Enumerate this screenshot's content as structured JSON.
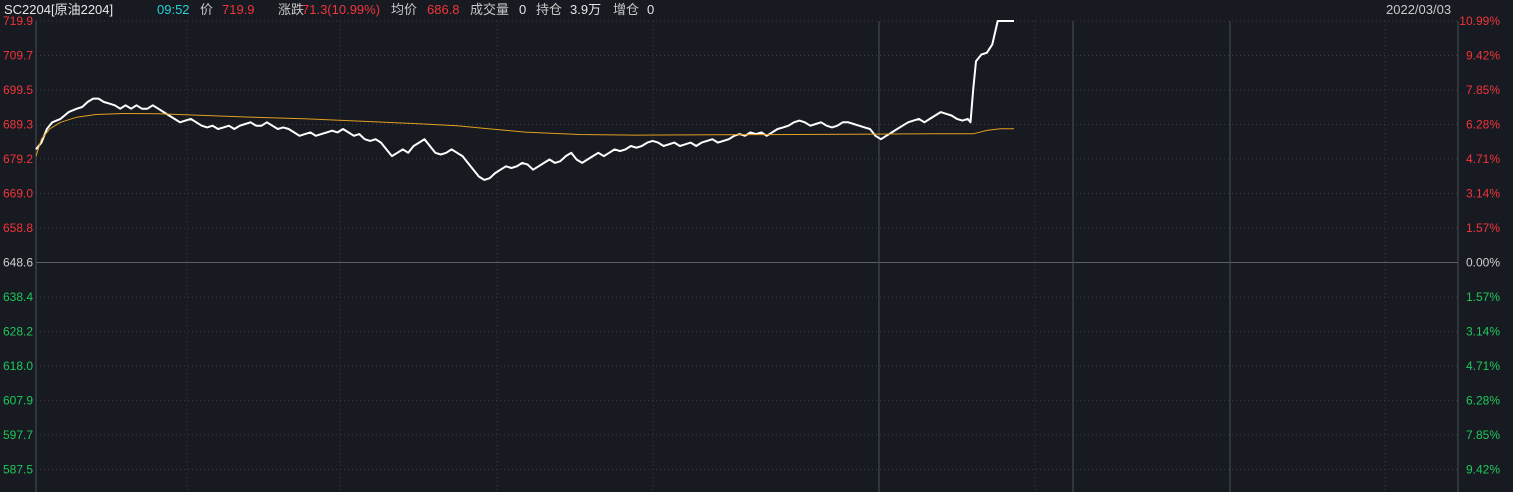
{
  "header": {
    "symbol": "SC2204[原油2204]",
    "time": "09:52",
    "price_label": "价",
    "price": "719.9",
    "change_label": "涨跌",
    "change": "71.3(10.99%)",
    "avg_label": "均价",
    "avg": "686.8",
    "volume_label": "成交量",
    "volume": "0",
    "oi_label": "持仓",
    "oi": "3.9万",
    "oi_change_label": "增仓",
    "oi_change": "0",
    "date": "2022/03/03"
  },
  "colors": {
    "background": "#171a21",
    "up": "#f0353b",
    "down": "#1ec85a",
    "neutral": "#d0d0d0",
    "price_line": "#ffffff",
    "avg_line": "#e0a020",
    "grid": "#3a3d44"
  },
  "chart_data": {
    "type": "line",
    "reference_price": 648.6,
    "ylim": [
      580.0,
      719.9
    ],
    "left_ticks": [
      "719.9",
      "709.7",
      "699.5",
      "689.3",
      "679.2",
      "669.0",
      "658.8",
      "648.6",
      "638.4",
      "628.2",
      "618.0",
      "607.9",
      "597.7",
      "587.5"
    ],
    "right_ticks": [
      "10.99%",
      "9.42%",
      "7.85%",
      "6.28%",
      "4.71%",
      "3.14%",
      "1.57%",
      "0.00%",
      "1.57%",
      "3.14%",
      "4.71%",
      "6.28%",
      "7.85%",
      "9.42%"
    ],
    "x_count": 360,
    "series": [
      {
        "key": "price",
        "points": [
          [
            0,
            682
          ],
          [
            2,
            684
          ],
          [
            4,
            688
          ],
          [
            6,
            690
          ],
          [
            9,
            691
          ],
          [
            12,
            693
          ],
          [
            15,
            694
          ],
          [
            17,
            694.5
          ],
          [
            19,
            696
          ],
          [
            21,
            697
          ],
          [
            23,
            697
          ],
          [
            25,
            696
          ],
          [
            27,
            695.5
          ],
          [
            29,
            695
          ],
          [
            31,
            694
          ],
          [
            33,
            695
          ],
          [
            35,
            694
          ],
          [
            37,
            695
          ],
          [
            39,
            694
          ],
          [
            41,
            694
          ],
          [
            43,
            695
          ],
          [
            45,
            694
          ],
          [
            47,
            693
          ],
          [
            49,
            692
          ],
          [
            51,
            691
          ],
          [
            53,
            690
          ],
          [
            55,
            690.5
          ],
          [
            57,
            691
          ],
          [
            59,
            690
          ],
          [
            61,
            689
          ],
          [
            63,
            688.5
          ],
          [
            65,
            689
          ],
          [
            67,
            688
          ],
          [
            69,
            688.5
          ],
          [
            71,
            689
          ],
          [
            73,
            688
          ],
          [
            75,
            689
          ],
          [
            77,
            689.5
          ],
          [
            79,
            690
          ],
          [
            81,
            689
          ],
          [
            83,
            689
          ],
          [
            85,
            690
          ],
          [
            87,
            689
          ],
          [
            89,
            688
          ],
          [
            91,
            688.5
          ],
          [
            93,
            688
          ],
          [
            95,
            687
          ],
          [
            97,
            686
          ],
          [
            99,
            686.5
          ],
          [
            101,
            687
          ],
          [
            103,
            686
          ],
          [
            105,
            686.5
          ],
          [
            107,
            687
          ],
          [
            109,
            687.5
          ],
          [
            111,
            687
          ],
          [
            113,
            688
          ],
          [
            115,
            687
          ],
          [
            117,
            686
          ],
          [
            119,
            686.5
          ],
          [
            121,
            685
          ],
          [
            123,
            684.5
          ],
          [
            125,
            685
          ],
          [
            127,
            684
          ],
          [
            129,
            682
          ],
          [
            131,
            680
          ],
          [
            133,
            681
          ],
          [
            135,
            682
          ],
          [
            137,
            681
          ],
          [
            139,
            683
          ],
          [
            141,
            684
          ],
          [
            143,
            685
          ],
          [
            145,
            683
          ],
          [
            147,
            681
          ],
          [
            149,
            680.5
          ],
          [
            151,
            681
          ],
          [
            153,
            682
          ],
          [
            155,
            681
          ],
          [
            157,
            680
          ],
          [
            159,
            678
          ],
          [
            161,
            676
          ],
          [
            163,
            674
          ],
          [
            165,
            673
          ],
          [
            167,
            673.5
          ],
          [
            169,
            675
          ],
          [
            171,
            676
          ],
          [
            173,
            677
          ],
          [
            175,
            676.5
          ],
          [
            177,
            677
          ],
          [
            179,
            678
          ],
          [
            181,
            677.5
          ],
          [
            183,
            676
          ],
          [
            185,
            677
          ],
          [
            187,
            678
          ],
          [
            189,
            679
          ],
          [
            191,
            678
          ],
          [
            193,
            678.5
          ],
          [
            195,
            680
          ],
          [
            197,
            681
          ],
          [
            199,
            679
          ],
          [
            201,
            678
          ],
          [
            203,
            679
          ],
          [
            205,
            680
          ],
          [
            207,
            681
          ],
          [
            209,
            680
          ],
          [
            211,
            681
          ],
          [
            213,
            682
          ],
          [
            215,
            681.5
          ],
          [
            217,
            682
          ],
          [
            219,
            683
          ],
          [
            221,
            682.5
          ],
          [
            223,
            683
          ],
          [
            225,
            684
          ],
          [
            227,
            684.5
          ],
          [
            229,
            684
          ],
          [
            231,
            683
          ],
          [
            233,
            683.5
          ],
          [
            235,
            684
          ],
          [
            237,
            683
          ],
          [
            239,
            683.5
          ],
          [
            241,
            684
          ],
          [
            243,
            683
          ],
          [
            245,
            684
          ],
          [
            247,
            684.5
          ],
          [
            249,
            685
          ],
          [
            251,
            684
          ],
          [
            253,
            684.5
          ],
          [
            255,
            685
          ],
          [
            257,
            686
          ],
          [
            259,
            686.5
          ],
          [
            261,
            686
          ],
          [
            263,
            687
          ],
          [
            265,
            686.5
          ],
          [
            267,
            687
          ],
          [
            269,
            686
          ],
          [
            271,
            687
          ],
          [
            273,
            688
          ],
          [
            275,
            688.5
          ],
          [
            277,
            689
          ],
          [
            279,
            690
          ],
          [
            281,
            690.5
          ],
          [
            283,
            690
          ],
          [
            285,
            689
          ],
          [
            287,
            689.5
          ],
          [
            289,
            690
          ],
          [
            291,
            689
          ],
          [
            293,
            688.5
          ],
          [
            295,
            689
          ],
          [
            297,
            690
          ],
          [
            299,
            690
          ],
          [
            301,
            689.5
          ],
          [
            303,
            689
          ],
          [
            305,
            688.5
          ],
          [
            307,
            688
          ],
          [
            309,
            686
          ],
          [
            311,
            685
          ],
          [
            313,
            686
          ],
          [
            315,
            687
          ],
          [
            317,
            688
          ],
          [
            319,
            689
          ],
          [
            321,
            690
          ],
          [
            323,
            690.5
          ],
          [
            325,
            691
          ],
          [
            327,
            690
          ],
          [
            329,
            691
          ],
          [
            331,
            692
          ],
          [
            333,
            693
          ],
          [
            335,
            692.5
          ],
          [
            337,
            692
          ],
          [
            339,
            691
          ],
          [
            341,
            690.5
          ],
          [
            343,
            691
          ],
          [
            344,
            690
          ],
          [
            345,
            700
          ],
          [
            346,
            708
          ],
          [
            348,
            710
          ],
          [
            350,
            710.5
          ],
          [
            352,
            713
          ],
          [
            354,
            719.9
          ],
          [
            356,
            719.9
          ],
          [
            358,
            719.9
          ],
          [
            360,
            719.9
          ]
        ]
      },
      {
        "key": "avg",
        "points": [
          [
            0,
            680
          ],
          [
            2,
            685
          ],
          [
            5,
            688
          ],
          [
            9,
            690
          ],
          [
            15,
            691.5
          ],
          [
            22,
            692.3
          ],
          [
            32,
            692.6
          ],
          [
            45,
            692.5
          ],
          [
            60,
            692.1
          ],
          [
            80,
            691.5
          ],
          [
            100,
            691
          ],
          [
            120,
            690.3
          ],
          [
            140,
            689.6
          ],
          [
            155,
            689
          ],
          [
            165,
            688.2
          ],
          [
            180,
            687.1
          ],
          [
            200,
            686.4
          ],
          [
            220,
            686.2
          ],
          [
            250,
            686.3
          ],
          [
            280,
            686.4
          ],
          [
            310,
            686.5
          ],
          [
            330,
            686.6
          ],
          [
            345,
            686.6
          ],
          [
            350,
            687.6
          ],
          [
            355,
            688.1
          ],
          [
            360,
            688.1
          ]
        ]
      }
    ]
  }
}
